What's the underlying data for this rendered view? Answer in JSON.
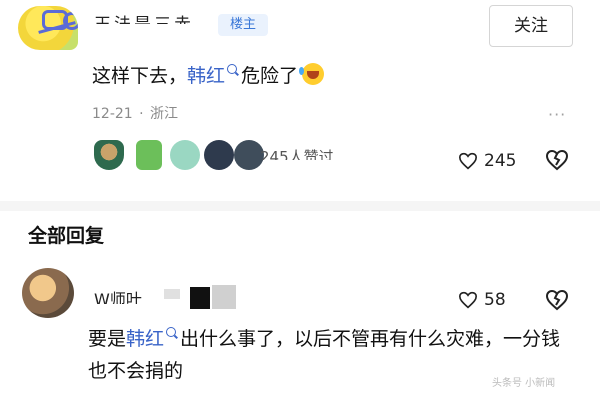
{
  "post": {
    "username": "王法是三赤",
    "owner_badge": "楼主",
    "follow_label": "关注",
    "comment_prefix": "这样下去，",
    "mention": "韩红",
    "comment_suffix": "危险了",
    "date": "12-21",
    "location": "浙江",
    "liked_by_text": "245人赞过",
    "like_count": "245"
  },
  "replies_section": {
    "title": "全部回复"
  },
  "reply": {
    "username": "W师叶",
    "like_count": "58",
    "text_prefix": "要是",
    "mention": "韩红",
    "text_suffix": "出什么事了，以后不管再有什么灾难，一分钱也不会捐的"
  },
  "watermark": "头条号 小新闻"
}
